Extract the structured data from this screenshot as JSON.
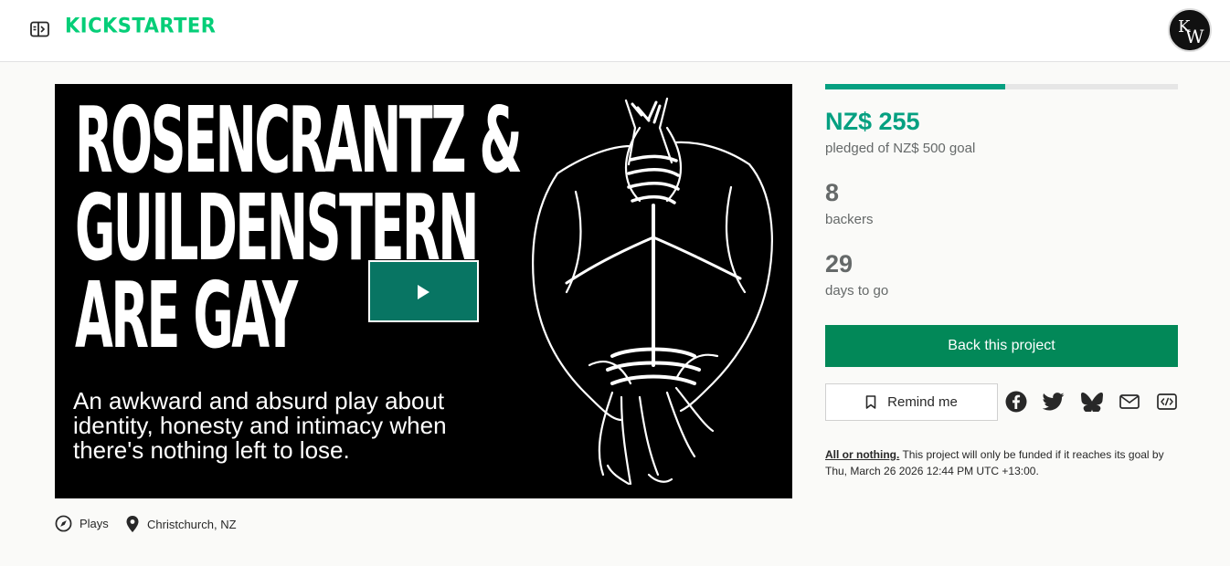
{
  "header": {
    "logo_text": "KICKSTARTER",
    "menu_icon": "sidebar-toggle-icon",
    "avatar_initials": "KW",
    "brand_color": "#05ce78"
  },
  "video": {
    "poster_title_lines": [
      "ROSENCRANTZ &",
      "GUILDENSTERN",
      "ARE GAY"
    ],
    "poster_subtitle_lines": [
      "An awkward and absurd play about",
      "identity, honesty and intimacy when",
      "there's nothing left to lose."
    ],
    "play_icon": "play-icon",
    "play_button_color": "#087563"
  },
  "meta": {
    "category": "Plays",
    "category_icon": "compass-icon",
    "location": "Christchurch, NZ",
    "location_icon": "map-pin-icon"
  },
  "funding": {
    "progress_fraction": 0.51,
    "pledged": "NZ$ 255",
    "pledged_label": "pledged of NZ$ 500 goal",
    "backers": "8",
    "backers_label": "backers",
    "days": "29",
    "days_label": "days to go",
    "accent_color": "#05a081"
  },
  "actions": {
    "back_label": "Back this project",
    "remind_label": "Remind me",
    "remind_icon": "bookmark-icon",
    "share_icons": [
      "facebook-icon",
      "twitter-icon",
      "bluesky-icon",
      "email-icon",
      "embed-icon"
    ]
  },
  "notice": {
    "link_text": "All or nothing.",
    "body_text": " This project will only be funded if it reaches its goal by Thu, March 26 2026 12:44 PM UTC +13:00."
  }
}
